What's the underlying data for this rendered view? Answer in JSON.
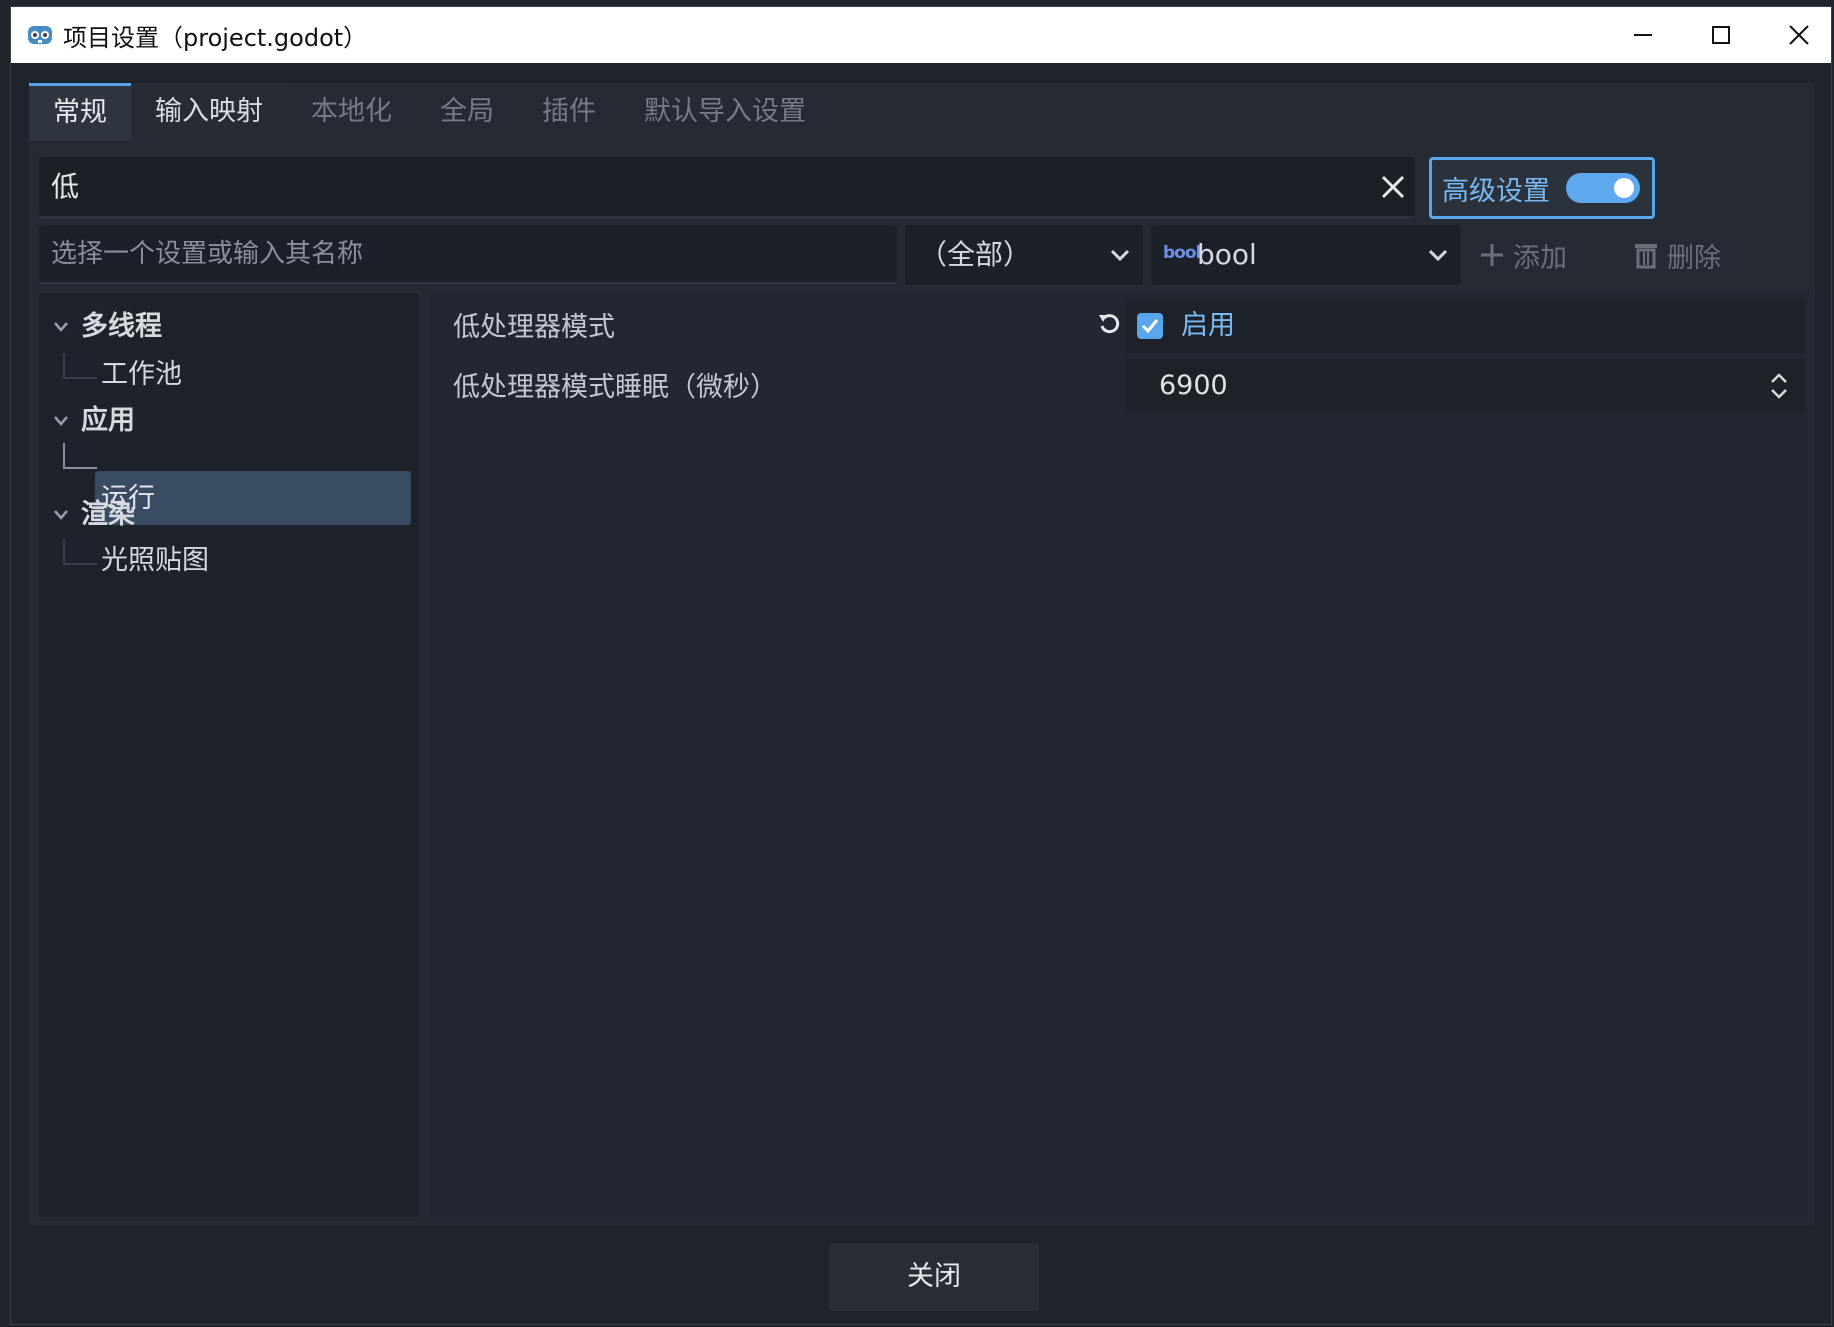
{
  "window": {
    "title": "项目设置（project.godot）"
  },
  "tabs": [
    {
      "label": "常规"
    },
    {
      "label": "输入映射"
    },
    {
      "label": "本地化"
    },
    {
      "label": "全局"
    },
    {
      "label": "插件"
    },
    {
      "label": "默认导入设置"
    }
  ],
  "search": {
    "value": "低",
    "advanced_label": "高级设置",
    "advanced_enabled": true
  },
  "property_bar": {
    "placeholder": "选择一个设置或输入其名称",
    "category": "（全部）",
    "type_icon": "bool",
    "type": "bool",
    "add_label": "添加",
    "delete_label": "删除"
  },
  "tree": {
    "sections": [
      {
        "label": "多线程",
        "items": [
          "工作池"
        ]
      },
      {
        "label": "应用",
        "items": [
          "运行"
        ]
      },
      {
        "label": "渲染",
        "items": [
          "光照贴图"
        ]
      }
    ],
    "selected": "运行"
  },
  "properties": [
    {
      "label": "低处理器模式",
      "value": "启用",
      "checked": true
    },
    {
      "label": "低处理器模式睡眠（微秒）",
      "value": "6900"
    }
  ],
  "footer": {
    "close_label": "关闭"
  },
  "colors": {
    "accent": "#5aa6ea",
    "background": "#1f232b",
    "selection": "#3a4c63"
  }
}
